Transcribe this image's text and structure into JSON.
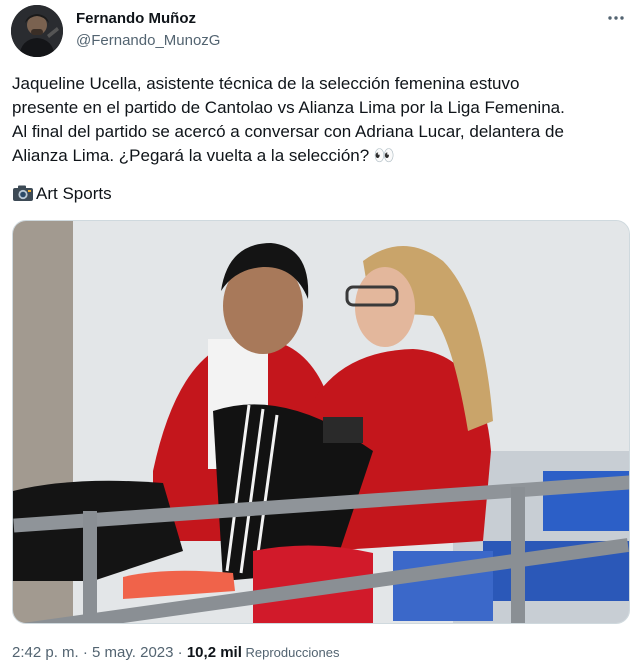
{
  "author": {
    "display_name": "Fernando Muñoz",
    "handle": "@Fernando_MunozG"
  },
  "tweet": {
    "text": "Jaqueline Ucella, asistente técnica de la selección femenina estuvo\npresente en el partido de Cantolao vs Alianza Lima por la Liga Femenina.\nAl final del partido se acercó a conversar con Adriana Lucar, delantera de\nAlianza Lima. ¿Pegará la vuelta a la selección? 👀",
    "credit_icon": "camera-icon",
    "credit": "Art Sports"
  },
  "meta": {
    "time": "2:42 p. m.",
    "separator1": " · ",
    "date": "5 may. 2023",
    "separator2": " · ",
    "views_count": "10,2 mil",
    "views_label": " Reproducciones"
  },
  "colors": {
    "text": "#0f1419",
    "secondary": "#536471",
    "border": "#cfd9de",
    "jacket_red": "#c8102e"
  },
  "icons": {
    "more": "more-icon"
  }
}
